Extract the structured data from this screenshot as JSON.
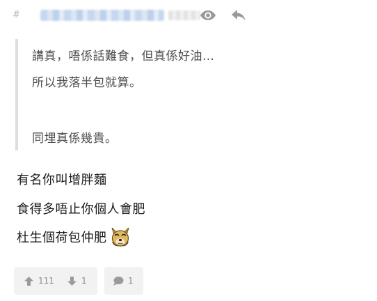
{
  "header": {
    "hash_prefix": "#",
    "icons": [
      "eye-icon",
      "reply-icon"
    ]
  },
  "quote": {
    "lines": [
      "講真，唔係話難食，但真係好油…",
      "所以我落半包就算。",
      "同埋真係幾貴。"
    ]
  },
  "body": {
    "lines": [
      "有名你叫增胖麵",
      "食得多唔止你個人會肥",
      "杜生個荷包仲肥"
    ],
    "emoji": "dog-face-emoji"
  },
  "footer": {
    "upvote_count": "111",
    "downvote_count": "1",
    "comment_count": "1"
  },
  "colors": {
    "quote_border": "#dedede",
    "footer_bg": "#f2f2f2",
    "icon_gray": "#9a9a9a"
  }
}
